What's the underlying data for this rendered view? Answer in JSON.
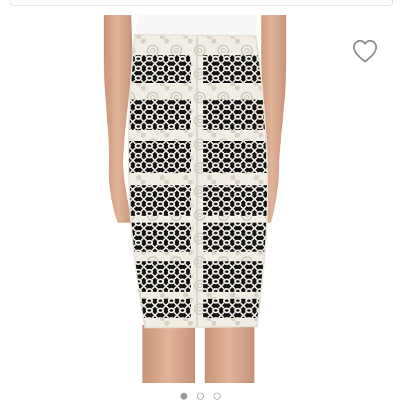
{
  "listing": {
    "photo_description": "",
    "carousel": {
      "current": 1,
      "total": 3
    }
  },
  "icons": {
    "like": "heart-outline-icon"
  },
  "colors": {
    "background": "#ffffff",
    "skin": "#d9a98b",
    "skirt_lace": "#f1ede4",
    "skirt_lining": "#151515",
    "heart_stroke": "#8c8c8c"
  }
}
